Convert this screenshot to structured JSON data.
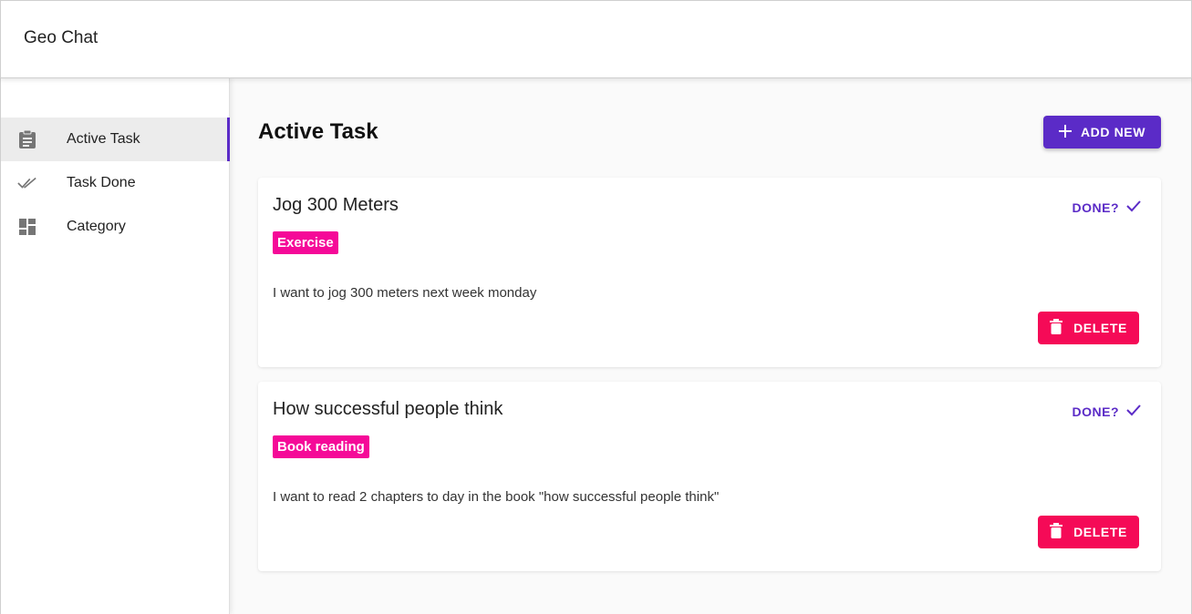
{
  "app": {
    "title": "Geo Chat"
  },
  "sidebar": {
    "items": [
      {
        "label": "Active Task",
        "icon": "clipboard-icon",
        "active": true
      },
      {
        "label": "Task Done",
        "icon": "double-check-icon",
        "active": false
      },
      {
        "label": "Category",
        "icon": "dashboard-icon",
        "active": false
      }
    ]
  },
  "main": {
    "title": "Active Task",
    "add_button_label": "ADD NEW",
    "tasks": [
      {
        "title": "Jog 300 Meters",
        "category": "Exercise",
        "description": "I want to jog 300 meters next week monday",
        "done_label": "DONE?",
        "delete_label": "DELETE"
      },
      {
        "title": "How successful people think",
        "category": "Book reading",
        "description": "I want to read 2 chapters to day in the book \"how successful people think\"",
        "done_label": "DONE?",
        "delete_label": "DELETE"
      }
    ]
  },
  "colors": {
    "primary": "#5b2bc7",
    "chip": "#f50a98",
    "delete": "#f50a57"
  }
}
